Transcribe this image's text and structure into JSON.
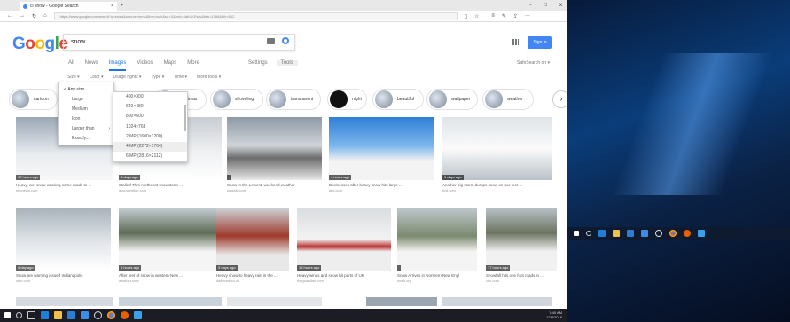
{
  "browser": {
    "tab_title": "ci snow - Google Search",
    "url": "https://www.google.com/search?q=snow&source=lnms&tbm=isch&sa=X&ved=0ahUKEwiv&biw=1366&bih=662",
    "window_controls": [
      "-",
      "□",
      "x"
    ]
  },
  "search": {
    "query": "snow",
    "sign_in": "Sign in"
  },
  "nav": {
    "tabs": [
      "All",
      "News",
      "Images",
      "Videos",
      "Maps",
      "More"
    ],
    "settings": "Settings",
    "tools": "Tools",
    "safesearch": "SafeSearch on ▾"
  },
  "tools_row": [
    "Size ▾",
    "Color ▾",
    "Usage rights ▾",
    "Type ▾",
    "Time ▾",
    "More tools ▾"
  ],
  "size_menu": [
    "Any size",
    "Large",
    "Medium",
    "Icon",
    "Larger than",
    "Exactly..."
  ],
  "larger_than_menu": [
    "400×300",
    "640×480",
    "800×600",
    "1024×768",
    "2 MP (1600×1200)",
    "4 MP (2272×1704)",
    "6 MP (2816×2112)"
  ],
  "chips": [
    "cartoon",
    "christmas",
    "shoveling",
    "transparent",
    "night",
    "beautiful",
    "wallpaper",
    "weather"
  ],
  "results": [
    {
      "age": "17 hours ago",
      "caption": "Heavy, wet snow causing some roads to ...",
      "domain": "nbcnews.com"
    },
    {
      "age": "4 days ago",
      "caption": "Stalled Thrs northeast snowstorm ...",
      "domain": "accuweather.com"
    },
    {
      "age": "",
      "caption": "Snow in the Lowest: weekend weather",
      "domain": "kaldatv.com"
    },
    {
      "age": "4 hours ago",
      "caption": "Businesses after heavy snow hits large ...",
      "domain": "abc.com"
    },
    {
      "age": "1 days ago",
      "caption": "Another big storm dumps snow on two feet ...",
      "domain": "kcd.com"
    },
    {
      "age": "4 day ago",
      "caption": "Snow are warning issued Indianapolis",
      "domain": "wthr.com"
    },
    {
      "age": "4 hours ago",
      "caption": "After feet of snow in western New ...",
      "domain": "weather.com"
    },
    {
      "age": "3 days ago",
      "caption": "Heavy snow to heavy rain in the ...",
      "domain": "dailymail.co.uk"
    },
    {
      "age": "15 hours ago",
      "caption": "Heavy winds and snow hit parts of UK",
      "domain": "theguardian.com"
    },
    {
      "age": "",
      "caption": "Snow Arrives in Northern New Engl",
      "domain": "wcsh.org"
    },
    {
      "age": "17 hours ago",
      "caption": "Snowfall hits one foot roads in ...",
      "domain": "cbs.com"
    }
  ],
  "tray": {
    "time": "7:40 AM",
    "date": "12/8/2016"
  }
}
